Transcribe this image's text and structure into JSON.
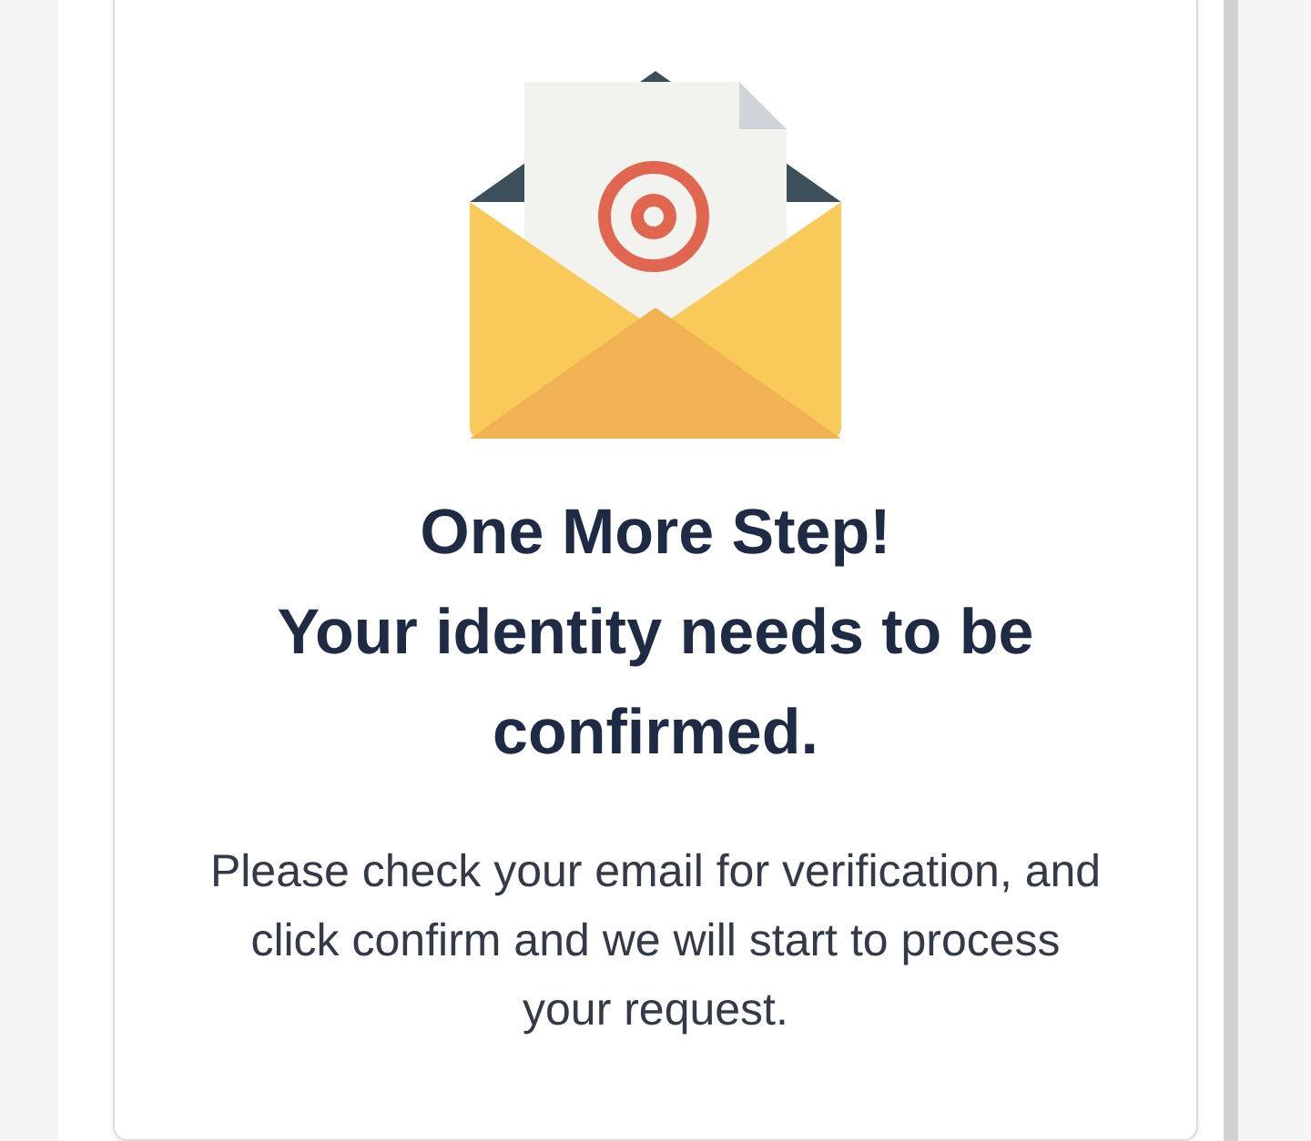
{
  "card": {
    "icon": {
      "kind": "envelope"
    },
    "headings": [
      "One More Step!",
      "Your identity needs to be confirmed."
    ],
    "message": "Please check your email for verification, and click confirm and we will start to process your request."
  }
}
